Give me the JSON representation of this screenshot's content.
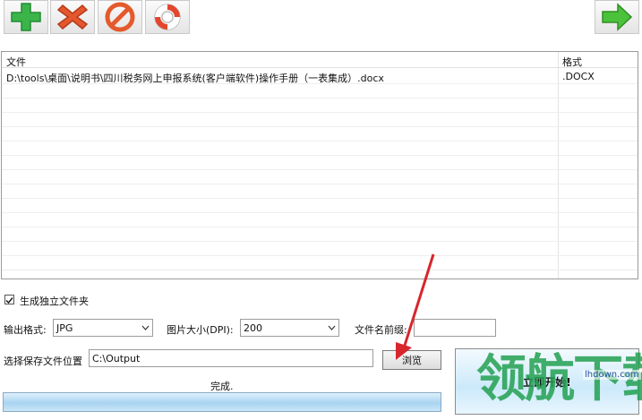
{
  "toolbar": {
    "icons": [
      "add-icon",
      "delete-icon",
      "clear-icon",
      "help-icon",
      "next-arrow-icon"
    ]
  },
  "file_list": {
    "columns": [
      "文件",
      "格式"
    ],
    "rows": [
      {
        "path": "D:\\tools\\桌面\\说明书\\四川税务网上申报系统(客户端软件)操作手册（一表集成）.docx",
        "format": ".DOCX"
      }
    ]
  },
  "options": {
    "separate_folder_label": "生成独立文件夹",
    "separate_folder_checked": true,
    "output_format_label": "输出格式:",
    "output_format_value": "JPG",
    "image_size_label": "图片大小(DPI):",
    "image_size_value": "200",
    "prefix_label": "文件名前缀:",
    "prefix_value": ""
  },
  "save": {
    "label": "选择保存文件位置",
    "path": "C:\\Output",
    "browse_label": "浏览"
  },
  "status": {
    "text": "完成."
  },
  "start_button": {
    "label": "立即开始!"
  },
  "watermark": {
    "text": "领航下载",
    "url": "lhdown.com"
  },
  "colors": {
    "add": "#3bb54a",
    "delete": "#e4572e",
    "clear": "#e45a2c",
    "arrow": "#4cc23c",
    "annotation": "#d7262c"
  }
}
